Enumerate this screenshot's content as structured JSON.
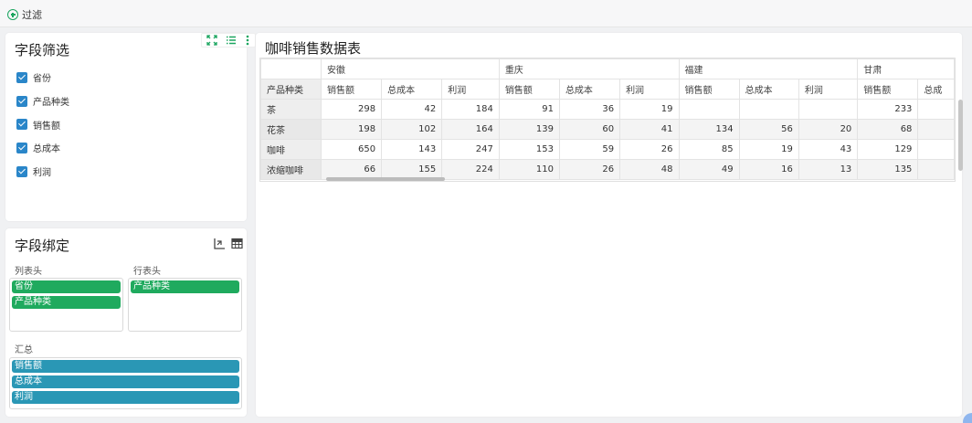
{
  "toolbar": {
    "filter_label": "过滤"
  },
  "filter_panel": {
    "title": "字段筛选",
    "fields": [
      "省份",
      "产品种类",
      "销售额",
      "总成本",
      "利润"
    ]
  },
  "bind_panel": {
    "title": "字段绑定",
    "column_header_label": "列表头",
    "row_header_label": "行表头",
    "summary_label": "汇总",
    "column_fields": [
      "省份",
      "产品种类"
    ],
    "row_fields": [
      "产品种类"
    ],
    "summary_fields": [
      "销售额",
      "总成本",
      "利润"
    ]
  },
  "table": {
    "title": "咖啡销售数据表",
    "row_header_title": "产品种类",
    "provinces": [
      "安徽",
      "重庆",
      "福建",
      "甘肃"
    ],
    "measures": [
      "销售额",
      "总成本",
      "利润"
    ],
    "rows": [
      {
        "label": "茶",
        "values": [
          "298",
          "42",
          "184",
          "91",
          "36",
          "19",
          "",
          "",
          "",
          "233",
          ""
        ]
      },
      {
        "label": "花茶",
        "values": [
          "198",
          "102",
          "164",
          "139",
          "60",
          "41",
          "134",
          "56",
          "20",
          "68",
          ""
        ]
      },
      {
        "label": "咖啡",
        "values": [
          "650",
          "143",
          "247",
          "153",
          "59",
          "26",
          "85",
          "19",
          "43",
          "129",
          ""
        ]
      },
      {
        "label": "浓缩咖啡",
        "values": [
          "66",
          "155",
          "224",
          "110",
          "26",
          "48",
          "49",
          "16",
          "13",
          "135",
          ""
        ]
      }
    ],
    "last_partial_header": "总成"
  },
  "colors": {
    "accent_green": "#1aa55f",
    "chip_green": "#1faa5e",
    "chip_blue": "#2a97b5",
    "checkbox_blue": "#2a86c9"
  }
}
